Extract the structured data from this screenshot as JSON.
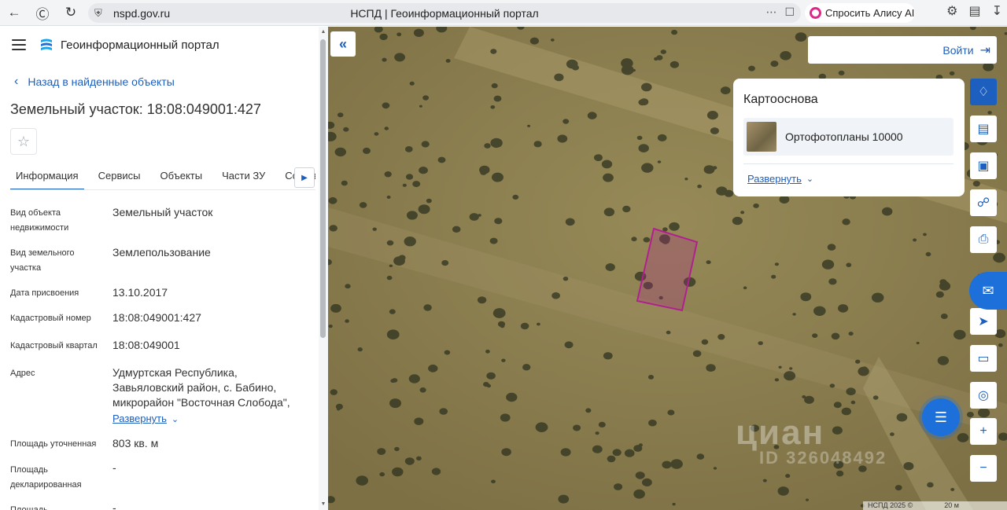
{
  "browser": {
    "url": "nspd.gov.ru",
    "tab_title": "НСПД | Геоинформационный портал",
    "alice_label": "Спросить Алису AI"
  },
  "header": {
    "portal_title": "Геоинформационный портал"
  },
  "nav": {
    "back_label": "Назад в найденные объекты"
  },
  "object": {
    "title": "Земельный участок: 18:08:049001:427"
  },
  "tabs": [
    {
      "label": "Информация",
      "active": true
    },
    {
      "label": "Сервисы",
      "active": false
    },
    {
      "label": "Объекты",
      "active": false
    },
    {
      "label": "Части ЗУ",
      "active": false
    },
    {
      "label": "Состав",
      "active": false
    }
  ],
  "properties": [
    {
      "label": "Вид объекта недвижимости",
      "value": "Земельный участок"
    },
    {
      "label": "Вид земельного участка",
      "value": "Землепользование"
    },
    {
      "label": "Дата присвоения",
      "value": "13.10.2017"
    },
    {
      "label": "Кадастровый номер",
      "value": "18:08:049001:427"
    },
    {
      "label": "Кадастровый квартал",
      "value": "18:08:049001"
    },
    {
      "label": "Адрес",
      "value": "Удмуртская Республика, Завьяловский район, с. Бабино, микрорайон \"Восточная Слобода\","
    },
    {
      "label": "Площадь уточненная",
      "value": "803 кв. м"
    },
    {
      "label": "Площадь декларированная",
      "value": "-"
    },
    {
      "label": "Площадь",
      "value": "-"
    }
  ],
  "address_expand_label": "Развернуть",
  "map": {
    "login_label": "Войти",
    "basemap_title": "Картооснова",
    "basemap_layer": "Ортофотопланы 10000",
    "basemap_expand": "Развернуть",
    "watermark": "циан",
    "watermark_id": "ID 326048492",
    "attribution": "НСПД 2025 ©",
    "scale_label": "20 м",
    "parcel_color": "#b0208f"
  },
  "colors": {
    "accent": "#1d5fbf"
  },
  "icons": {
    "back": "arrow-left-icon",
    "star": "star-icon",
    "login": "login-arrow-icon"
  }
}
